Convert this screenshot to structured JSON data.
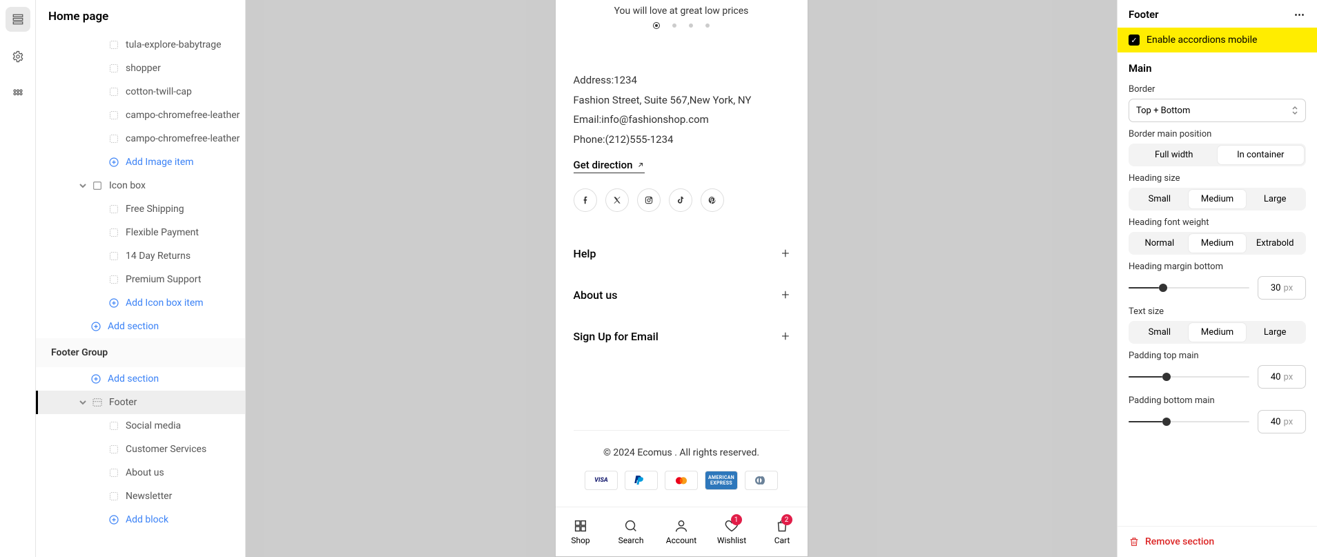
{
  "page_title": "Home page",
  "rail": {
    "icons": [
      "sections",
      "settings",
      "apps"
    ]
  },
  "tree": {
    "image_items": [
      "tula-explore-babytrage",
      "shopper",
      "cotton-twill-cap",
      "campo-chromefree-leather",
      "campo-chromefree-leather"
    ],
    "add_image_item": "Add Image item",
    "icon_box": {
      "label": "Icon box",
      "items": [
        "Free Shipping",
        "Flexible Payment",
        "14 Day Returns",
        "Premium Support"
      ],
      "add": "Add Icon box item"
    },
    "add_section": "Add section",
    "footer_group": {
      "label": "Footer Group",
      "add_section": "Add section",
      "footer": {
        "label": "Footer",
        "blocks": [
          "Social media",
          "Customer Services",
          "About us",
          "Newsletter"
        ],
        "add_block": "Add block"
      }
    }
  },
  "preview": {
    "hero_line": "You will love at great low prices",
    "address_label": "Address:",
    "address_value": "1234",
    "address_line2": "Fashion Street, Suite 567,New York, NY",
    "email_label": "Email:",
    "email_value": "info@fashionshop.com",
    "phone_label": "Phone:",
    "phone_value": "(212)555-1234",
    "get_direction": "Get direction",
    "accordion": [
      "Help",
      "About us",
      "Sign Up for Email"
    ],
    "copyright": "© 2024 Ecomus . All rights reserved.",
    "payments": [
      "visa",
      "paypal",
      "mastercard",
      "amex",
      "diners"
    ],
    "tabs": [
      {
        "label": "Shop",
        "icon": "shop"
      },
      {
        "label": "Search",
        "icon": "search"
      },
      {
        "label": "Account",
        "icon": "account"
      },
      {
        "label": "Wishlist",
        "icon": "heart",
        "badge": "1"
      },
      {
        "label": "Cart",
        "icon": "bag",
        "badge": "2"
      }
    ]
  },
  "panel": {
    "title": "Footer",
    "enable_label": "Enable accordions mobile",
    "main_heading": "Main",
    "border_label": "Border",
    "border_value": "Top + Bottom",
    "border_position_label": "Border main position",
    "border_position_options": [
      "Full width",
      "In container"
    ],
    "border_position_selected": 1,
    "heading_size_label": "Heading size",
    "heading_size_options": [
      "Small",
      "Medium",
      "Large"
    ],
    "heading_size_selected": 1,
    "heading_weight_label": "Heading font weight",
    "heading_weight_options": [
      "Normal",
      "Medium",
      "Extrabold"
    ],
    "heading_weight_selected": 1,
    "heading_margin_label": "Heading margin bottom",
    "heading_margin_value": "30",
    "heading_margin_unit": "px",
    "heading_margin_pct": 25,
    "text_size_label": "Text size",
    "text_size_options": [
      "Small",
      "Medium",
      "Large"
    ],
    "text_size_selected": 1,
    "padding_top_label": "Padding top main",
    "padding_top_value": "40",
    "padding_top_unit": "px",
    "padding_top_pct": 28,
    "padding_bottom_label": "Padding bottom main",
    "padding_bottom_value": "40",
    "padding_bottom_unit": "px",
    "padding_bottom_pct": 28,
    "remove": "Remove section"
  }
}
